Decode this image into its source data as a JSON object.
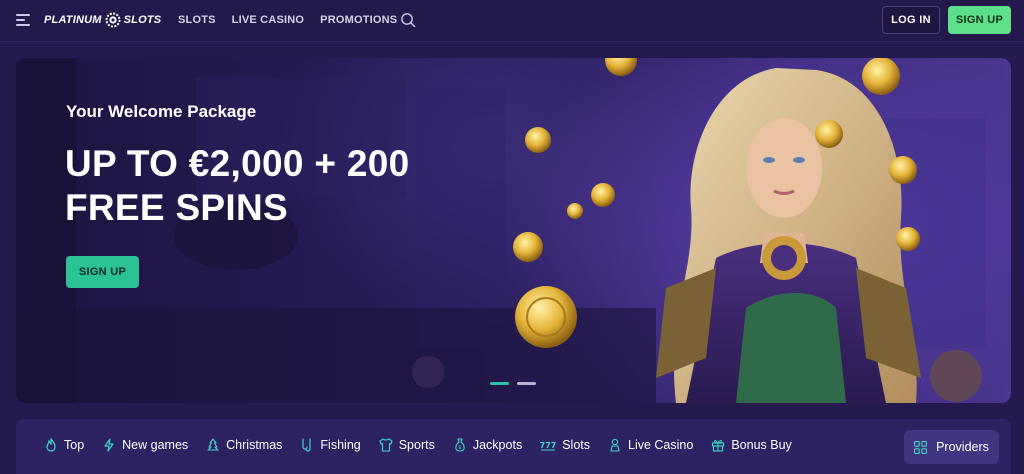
{
  "header": {
    "logo_left": "PLATINUM",
    "logo_right": "SLOTS",
    "nav": [
      "SLOTS",
      "LIVE CASINO",
      "PROMOTIONS"
    ],
    "login_label": "LOG IN",
    "signup_label": "SIGN UP"
  },
  "hero": {
    "subtitle": "Your Welcome Package",
    "title_line1": "UP TO €2,000 + 200",
    "title_line2": "FREE SPINS",
    "cta_label": "SIGN UP",
    "carousel_slides": 2,
    "carousel_active": 1
  },
  "categories": {
    "items": [
      {
        "label": "Top",
        "icon": "flame-icon"
      },
      {
        "label": "New games",
        "icon": "lightning-icon"
      },
      {
        "label": "Christmas",
        "icon": "christmas-tree-icon"
      },
      {
        "label": "Fishing",
        "icon": "fishing-icon"
      },
      {
        "label": "Sports",
        "icon": "jersey-icon"
      },
      {
        "label": "Jackpots",
        "icon": "money-bag-icon"
      },
      {
        "label": "Slots",
        "icon": "slot-777-icon"
      },
      {
        "label": "Live Casino",
        "icon": "dealer-icon"
      },
      {
        "label": "Bonus Buy",
        "icon": "gift-icon"
      }
    ],
    "providers_label": "Providers"
  },
  "colors": {
    "background": "#241a4d",
    "accent_green": "#5de08a",
    "cta_teal": "#2bc295",
    "icon_teal": "#3dd6c4"
  }
}
